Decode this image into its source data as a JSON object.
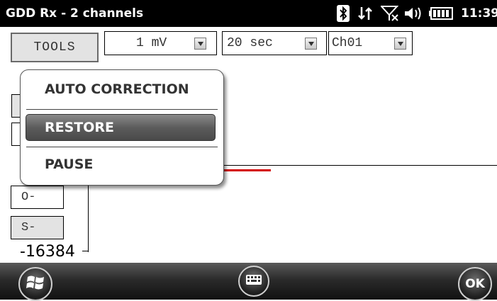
{
  "status_bar": {
    "title": "GDD Rx - 2 channels",
    "clock": "11:39",
    "icons": [
      "bluetooth-icon",
      "data-connection-icon",
      "no-signal-icon",
      "volume-icon",
      "battery-icon"
    ]
  },
  "toolbar": {
    "tools_label": "TOOLS",
    "scale_value": "1 mV",
    "time_value": "20 sec",
    "channel_value": "Ch01"
  },
  "menu": {
    "items": [
      "AUTO CORRECTION",
      "RESTORE",
      "PAUSE"
    ],
    "highlighted": "RESTORE"
  },
  "plot": {
    "y_min_label": "-16384",
    "offset_minus_label": "O-",
    "scale_minus_label": "S-",
    "signal_color": "#d40000"
  },
  "bottom_bar": {
    "ok_label": "OK",
    "icons": [
      "windows-start-icon",
      "keyboard-icon"
    ]
  }
}
